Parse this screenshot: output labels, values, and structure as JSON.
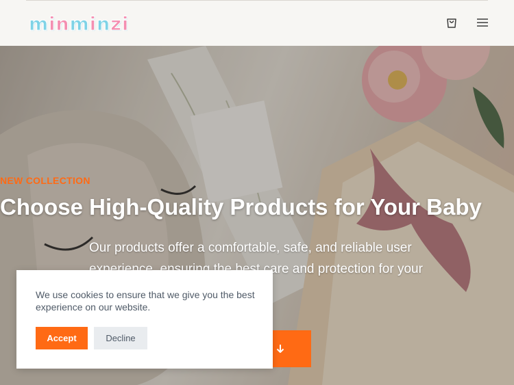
{
  "brand": {
    "logo_text": "minminzi",
    "letter_colors": [
      "#7fd3e6",
      "#f48fb1",
      "#f48fb1",
      "#7fd3e6",
      "#f48fb1",
      "#7fd3e6",
      "#f48fb1",
      "#f48fb1"
    ]
  },
  "header": {
    "icons": [
      "shopping-bag-icon",
      "hamburger-menu-icon"
    ]
  },
  "hero": {
    "eyebrow": "NEW COLLECTION",
    "title": "Choose High-Quality Products for Your Baby",
    "description": "Our products offer a comfortable, safe, and reliable user experience, ensuring the best care and protection for your",
    "cta_icon": "arrow-down-icon"
  },
  "cookie_banner": {
    "message": "We use cookies to ensure that we give you the best experience on our website.",
    "accept_label": "Accept",
    "decline_label": "Decline"
  },
  "colors": {
    "accent": "#ff6a14",
    "text_muted": "#4f5a67"
  }
}
